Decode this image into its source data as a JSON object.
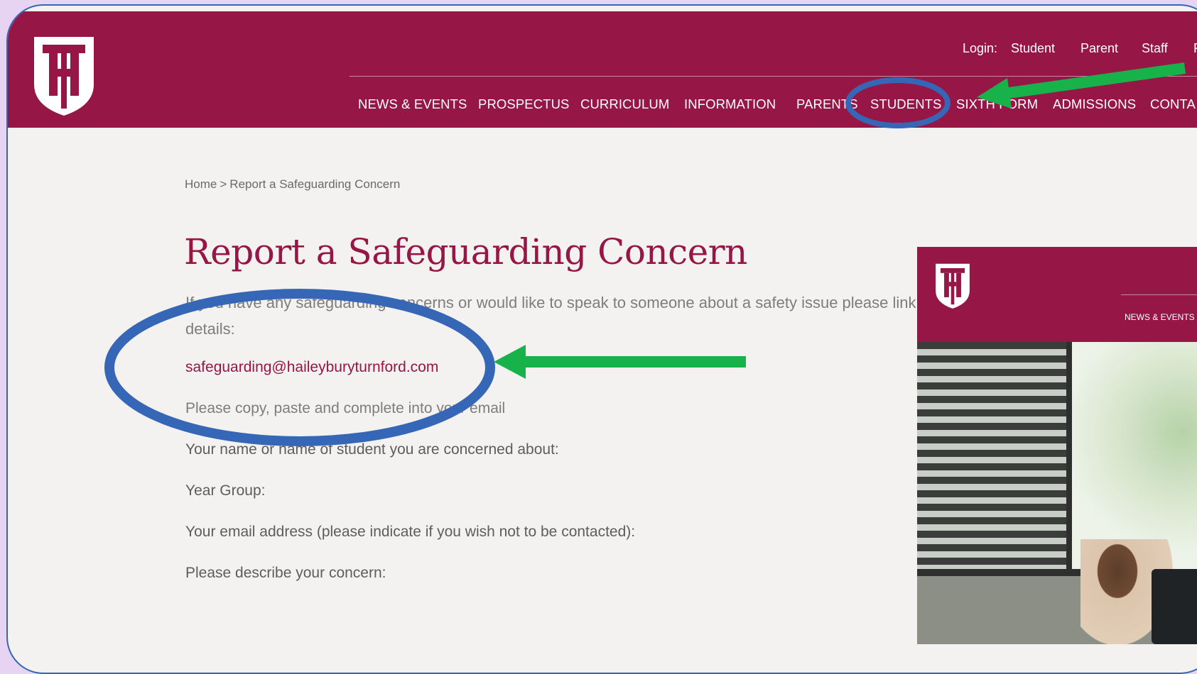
{
  "site": {
    "login_label": "Login:",
    "login_links": [
      "Student",
      "Parent",
      "Staff",
      "F"
    ],
    "nav": [
      "NEWS & EVENTS",
      "PROSPECTUS",
      "CURRICULUM",
      "INFORMATION",
      "PARENTS",
      "STUDENTS",
      "SIXTH FORM",
      "ADMISSIONS",
      "CONTA"
    ]
  },
  "breadcrumb": {
    "home": "Home",
    "separator": ">",
    "current": "Report a Safeguarding Concern"
  },
  "page": {
    "title": "Report a Safeguarding Concern",
    "intro": "If you have any safeguarding concerns or would like to speak to someone about a safety issue please link",
    "intro_cont": "details:",
    "email": "safeguarding@haileyburyturnford.com",
    "copy_note": "Please copy, paste and complete into your email",
    "fields": [
      "Your name or name of student you are concerned about:",
      "Year Group:",
      "Your email address (please indicate if you wish not to be contacted):",
      "Please describe your concern:"
    ]
  },
  "inset": {
    "nav_label": "NEWS & EVENTS"
  },
  "colors": {
    "brand": "#961645",
    "annotation_circle": "#3567b6",
    "annotation_arrow": "#17b34a",
    "page_bg": "#f4f1f1"
  },
  "icons": [
    "school-crest-icon",
    "annotation-circle",
    "annotation-arrow"
  ]
}
